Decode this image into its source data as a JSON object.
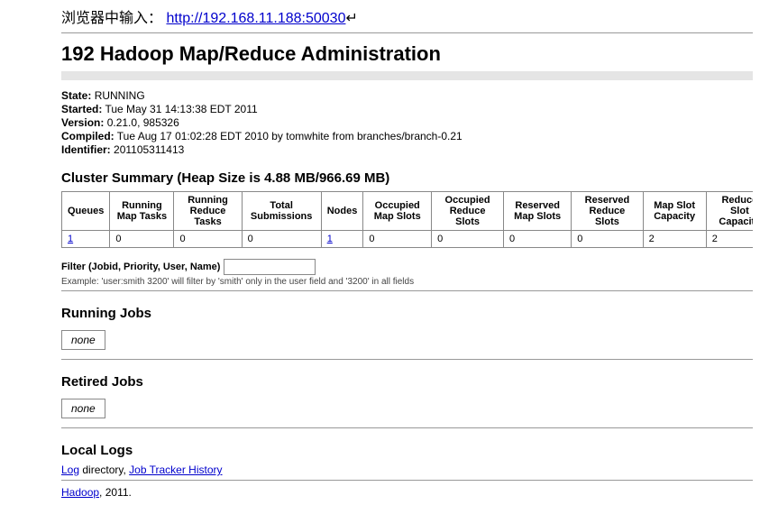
{
  "intro_label": "浏览器中输入：",
  "intro_url": "http://192.168.11.188:50030",
  "intro_suffix": "↵",
  "page_title": "192 Hadoop Map/Reduce Administration",
  "status": {
    "state_k": "State:",
    "state_v": "RUNNING",
    "started_k": "Started:",
    "started_v": "Tue May 31 14:13:38 EDT 2011",
    "version_k": "Version:",
    "version_v": "0.21.0, 985326",
    "compiled_k": "Compiled:",
    "compiled_v": "Tue Aug 17 01:02:28 EDT 2010 by tomwhite from branches/branch-0.21",
    "identifier_k": "Identifier:",
    "identifier_v": "201105311413"
  },
  "cluster_heading": "Cluster Summary (Heap Size is 4.88 MB/966.69 MB)",
  "cluster_headers": [
    "Queues",
    "Running Map Tasks",
    "Running Reduce Tasks",
    "Total Submissions",
    "Nodes",
    "Occupied Map Slots",
    "Occupied Reduce Slots",
    "Reserved Map Slots",
    "Reserved Reduce Slots",
    "Map Slot Capacity",
    "Reduce Slot Capacity"
  ],
  "cluster_row": {
    "queues": "1",
    "rmap": "0",
    "rred": "0",
    "tot": "0",
    "nodes": "1",
    "omap": "0",
    "ored": "0",
    "resmap": "0",
    "resred": "0",
    "mapcap": "2",
    "redcap": "2"
  },
  "filter_label": "Filter (Jobid, Priority, User, Name)",
  "filter_hint": "Example: 'user:smith 3200' will filter by 'smith' only in the user field and '3200' in all fields",
  "running_heading": "Running Jobs",
  "running_none": "none",
  "retired_heading": "Retired Jobs",
  "retired_none": "none",
  "locallogs_heading": "Local Logs",
  "log_link": "Log",
  "log_text_mid": " directory, ",
  "history_link": "Job Tracker History",
  "footer_link": "Hadoop",
  "footer_text": ", 2011."
}
